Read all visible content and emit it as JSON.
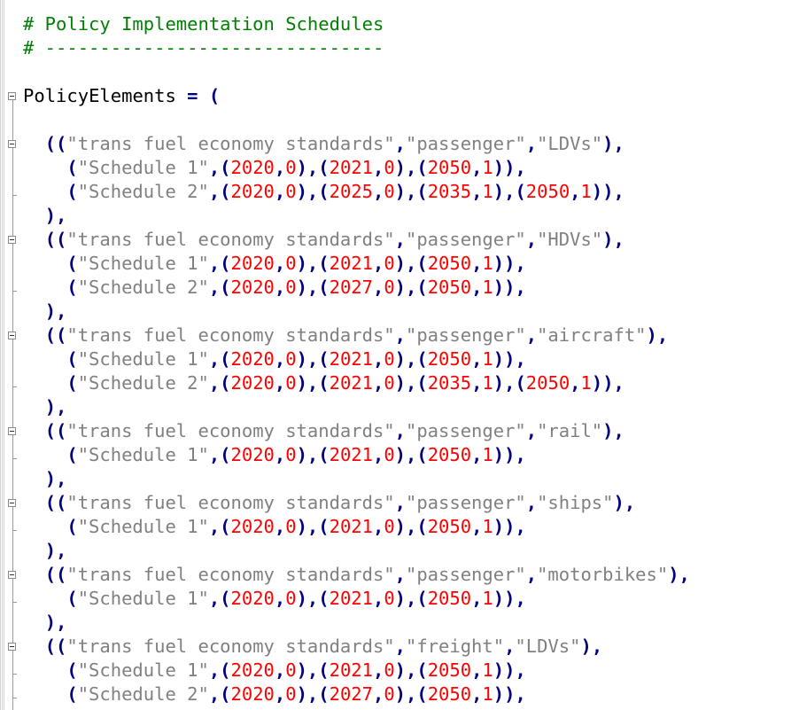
{
  "lines": [
    "# Policy Implementation Schedules",
    "# -------------------------------",
    "",
    "PolicyElements = (",
    "",
    "  ((\"trans fuel economy standards\",\"passenger\",\"LDVs\"),",
    "    (\"Schedule 1\",(2020,0),(2021,0),(2050,1)),",
    "    (\"Schedule 2\",(2020,0),(2025,0),(2035,1),(2050,1)),",
    "  ),",
    "  ((\"trans fuel economy standards\",\"passenger\",\"HDVs\"),",
    "    (\"Schedule 1\",(2020,0),(2021,0),(2050,1)),",
    "    (\"Schedule 2\",(2020,0),(2027,0),(2050,1)),",
    "  ),",
    "  ((\"trans fuel economy standards\",\"passenger\",\"aircraft\"),",
    "    (\"Schedule 1\",(2020,0),(2021,0),(2050,1)),",
    "    (\"Schedule 2\",(2020,0),(2021,0),(2035,1),(2050,1)),",
    "  ),",
    "  ((\"trans fuel economy standards\",\"passenger\",\"rail\"),",
    "    (\"Schedule 1\",(2020,0),(2021,0),(2050,1)),",
    "  ),",
    "  ((\"trans fuel economy standards\",\"passenger\",\"ships\"),",
    "    (\"Schedule 1\",(2020,0),(2021,0),(2050,1)),",
    "  ),",
    "  ((\"trans fuel economy standards\",\"passenger\",\"motorbikes\"),",
    "    (\"Schedule 1\",(2020,0),(2021,0),(2050,1)),",
    "  ),",
    "  ((\"trans fuel economy standards\",\"freight\",\"LDVs\"),",
    "    (\"Schedule 1\",(2020,0),(2021,0),(2050,1)),",
    "    (\"Schedule 2\",(2020,0),(2027,0),(2050,1)),"
  ],
  "colors": {
    "comment": "#008000",
    "string": "#808080",
    "number": "#ff0000",
    "operator": "#000080",
    "identifier": "#000000"
  }
}
